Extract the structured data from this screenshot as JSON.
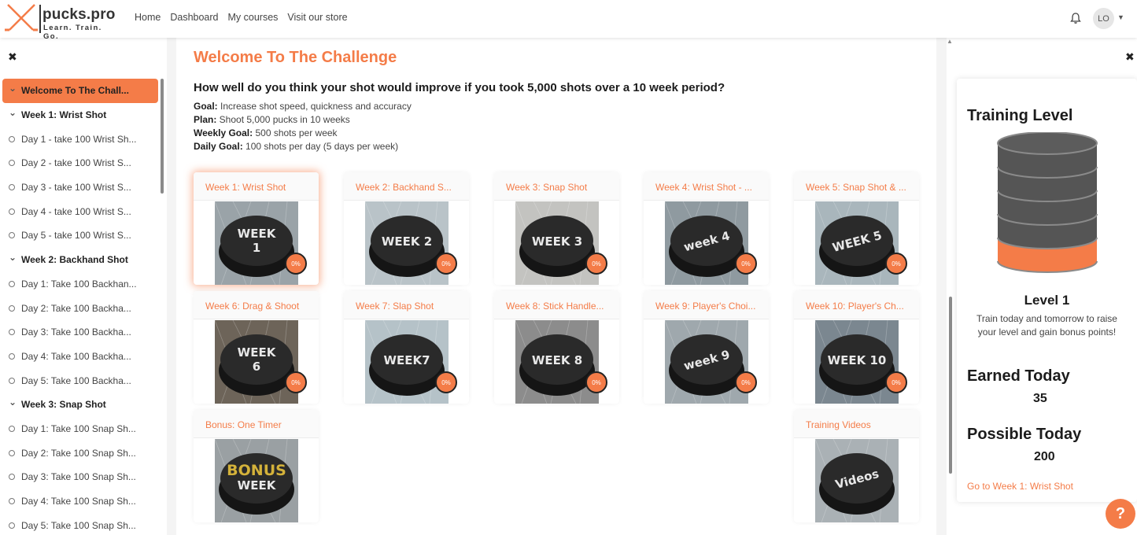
{
  "header": {
    "brand": "pucks.pro",
    "tagline": "Learn. Train. Go.",
    "nav": [
      "Home",
      "Dashboard",
      "My courses",
      "Visit our store"
    ],
    "avatar": "LO"
  },
  "sidebar": {
    "items": [
      {
        "label": "Welcome To The Chall...",
        "type": "active"
      },
      {
        "label": "Week 1: Wrist Shot",
        "type": "section"
      },
      {
        "label": "Day 1 - take 100 Wrist Sh...",
        "type": "day"
      },
      {
        "label": "Day 2 - take 100 Wrist S...",
        "type": "day"
      },
      {
        "label": "Day 3 - take 100 Wrist S...",
        "type": "day"
      },
      {
        "label": "Day 4 - take 100 Wrist S...",
        "type": "day"
      },
      {
        "label": "Day 5 - take 100 Wrist S...",
        "type": "day"
      },
      {
        "label": "Week 2: Backhand Shot",
        "type": "section"
      },
      {
        "label": "Day 1: Take 100 Backhan...",
        "type": "day"
      },
      {
        "label": "Day 2: Take 100 Backha...",
        "type": "day"
      },
      {
        "label": "Day 3: Take 100 Backha...",
        "type": "day"
      },
      {
        "label": "Day 4: Take 100 Backha...",
        "type": "day"
      },
      {
        "label": "Day 5: Take 100 Backha...",
        "type": "day"
      },
      {
        "label": "Week 3: Snap Shot",
        "type": "section"
      },
      {
        "label": "Day 1: Take 100 Snap Sh...",
        "type": "day"
      },
      {
        "label": "Day 2: Take 100 Snap Sh...",
        "type": "day"
      },
      {
        "label": "Day 3: Take 100 Snap Sh...",
        "type": "day"
      },
      {
        "label": "Day 4: Take 100 Snap Sh...",
        "type": "day"
      },
      {
        "label": "Day 5: Take 100 Snap Sh...",
        "type": "day"
      }
    ]
  },
  "main": {
    "title": "Welcome To The Challenge",
    "question": "How well do you think your shot would improve if you took 5,000 shots over a 10 week period?",
    "goals": [
      {
        "key": "Goal:",
        "value": "Increase shot speed, quickness and accuracy"
      },
      {
        "key": "Plan:",
        "value": "Shoot 5,000 pucks in 10 weeks"
      },
      {
        "key": "Weekly Goal:",
        "value": "500 shots per week"
      },
      {
        "key": "Daily Goal:",
        "value": "100 shots per day (5 days per week)"
      }
    ],
    "cards": [
      {
        "title": "Week 1: Wrist Shot",
        "puck": [
          "WEEK",
          "1"
        ],
        "progress": "0%"
      },
      {
        "title": "Week 2: Backhand S...",
        "puck": [
          "WEEK 2"
        ],
        "progress": "0%"
      },
      {
        "title": "Week 3: Snap Shot",
        "puck": [
          "WEEK 3"
        ],
        "progress": "0%"
      },
      {
        "title": "Week 4: Wrist Shot - ...",
        "puck": [
          "week 4"
        ],
        "progress": "0%"
      },
      {
        "title": "Week 5: Snap Shot & ...",
        "puck": [
          "WEEK 5"
        ],
        "progress": "0%"
      },
      {
        "title": "Week 6: Drag & Shoot",
        "puck": [
          "WEEK",
          "6"
        ],
        "progress": "0%"
      },
      {
        "title": "Week 7: Slap Shot",
        "puck": [
          "WEEK7"
        ],
        "progress": "0%"
      },
      {
        "title": "Week 8: Stick Handle...",
        "puck": [
          "WEEK 8"
        ],
        "progress": "0%"
      },
      {
        "title": "Week 9: Player's Choi...",
        "puck": [
          "week 9"
        ],
        "progress": "0%"
      },
      {
        "title": "Week 10: Player's Ch...",
        "puck": [
          "WEEK 10"
        ],
        "progress": "0%"
      },
      {
        "title": "Bonus: One Timer",
        "puck": [
          "BONUS",
          "WEEK"
        ],
        "progress": ""
      },
      {
        "title": "Training Videos",
        "puck": [
          "Videos"
        ],
        "progress": ""
      }
    ]
  },
  "right": {
    "title": "Training Level",
    "level": "Level 1",
    "message": "Train today and tomorrow to raise your level and gain bonus points!",
    "earned_label": "Earned Today",
    "earned_value": "35",
    "possible_label": "Possible Today",
    "possible_value": "200",
    "link": "Go to Week 1: Wrist Shot",
    "level_fill": 0.2
  },
  "help": "?",
  "colors": {
    "accent": "#f47c48"
  }
}
